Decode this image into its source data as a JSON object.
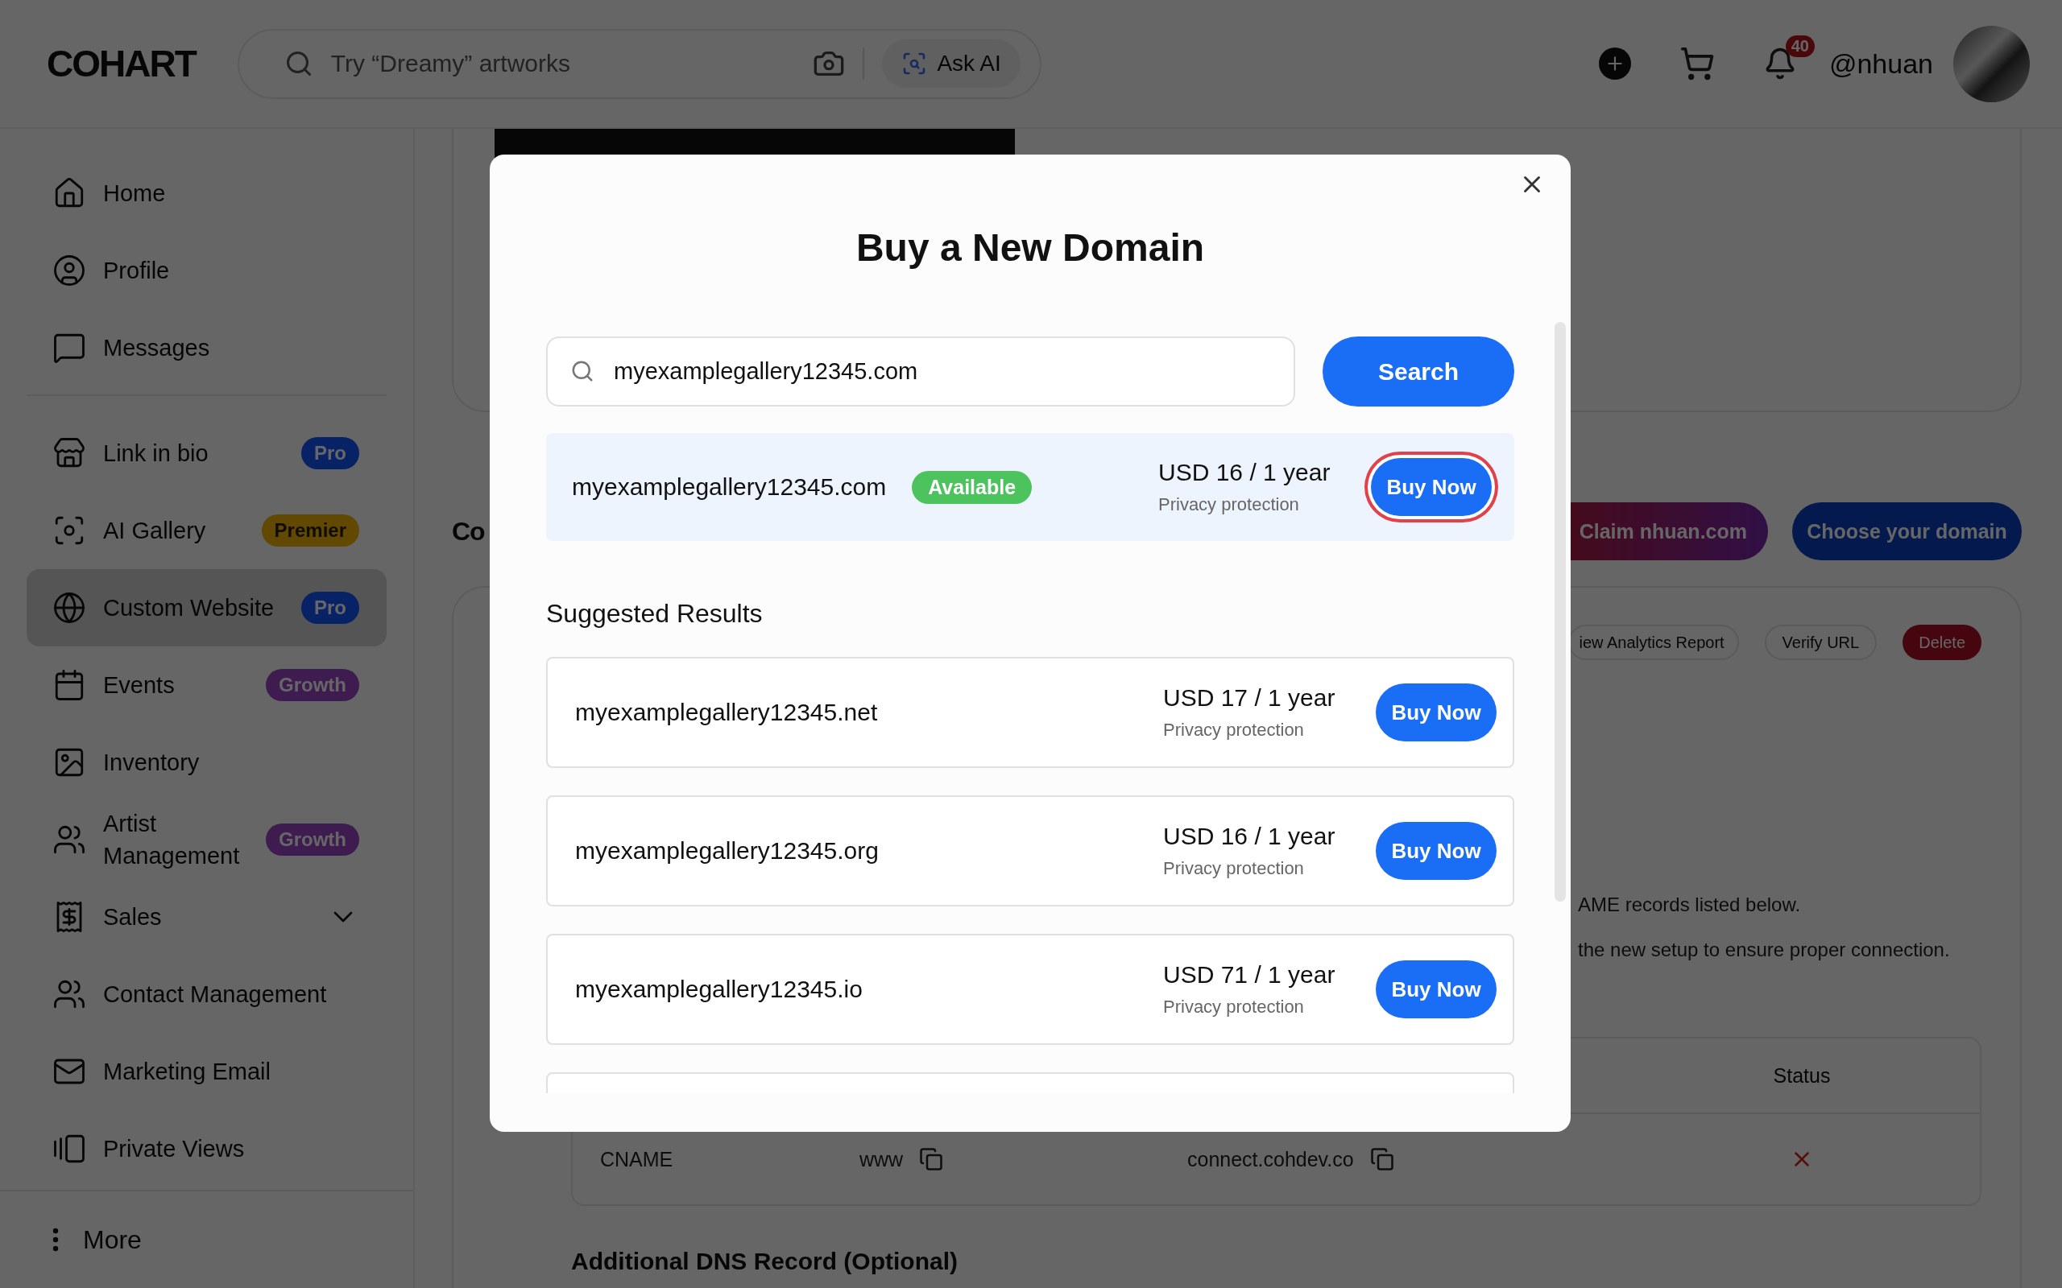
{
  "header": {
    "logo": "COHART",
    "search_placeholder": "Try “Dreamy” artworks",
    "ask_ai": "Ask AI",
    "notifications": "40",
    "username": "@nhuan"
  },
  "sidebar": {
    "groups": [
      [
        {
          "label": "Home",
          "selected": false
        },
        {
          "label": "Profile",
          "selected": false
        },
        {
          "label": "Messages",
          "selected": false
        }
      ],
      [
        {
          "label": "Link in bio",
          "badge": "Pro",
          "color": "#082266",
          "selected": false
        },
        {
          "label": "AI Gallery",
          "badge": "Premier",
          "color": "#614902",
          "selected": false
        },
        {
          "label": "Custom Website",
          "badge": "Pro",
          "color": "#082266",
          "selected": true
        },
        {
          "label": "Events",
          "badge": "Growth",
          "color": "#3e1c50",
          "selected": false
        },
        {
          "label": "Inventory",
          "selected": false
        },
        {
          "label": "Artist Management",
          "badge": "Growth",
          "color": "#3e1c50",
          "selected": false
        },
        {
          "label": "Sales",
          "expanded": false,
          "selected": false
        },
        {
          "label": "Contact Management",
          "selected": false
        },
        {
          "label": "Marketing Email",
          "selected": false
        },
        {
          "label": "Private Views",
          "selected": false
        }
      ]
    ],
    "more": "More"
  },
  "page": {
    "heading": "Co",
    "domain_buttons": [
      {
        "label": "Claim nhuan.com",
        "kind": "gradient"
      },
      {
        "label": "Choose your domain",
        "kind": "primary"
      }
    ],
    "card_actions": [
      {
        "label": "iew Analytics Report",
        "kind": "outline"
      },
      {
        "label": "Verify URL",
        "kind": "outline"
      },
      {
        "label": "Delete",
        "kind": "danger"
      }
    ],
    "notes": [
      "AME records listed below.",
      "the new setup to ensure proper connection."
    ],
    "dns_table": {
      "status_header": "Status",
      "rows": [
        {
          "type": "CNAME",
          "host": "www",
          "value": "connect.cohdev.co",
          "verified": false
        }
      ]
    },
    "additional_heading": "Additional DNS Record (Optional)"
  },
  "modal": {
    "title": "Buy a New Domain",
    "search": {
      "value": "myexamplegallery12345.com"
    },
    "search_button": "Search",
    "result": {
      "domain": "myexamplegallery12345.com",
      "status": "Available",
      "price": "USD 16 / 1 year",
      "note": "Privacy protection",
      "button": "Buy Now",
      "focused": true
    },
    "suggested_title": "Suggested Results",
    "suggestions": [
      {
        "domain": "myexamplegallery12345.net",
        "price": "USD 17 / 1 year",
        "note": "Privacy protection",
        "button": "Buy Now"
      },
      {
        "domain": "myexamplegallery12345.org",
        "price": "USD 16 / 1 year",
        "note": "Privacy protection",
        "button": "Buy Now"
      },
      {
        "domain": "myexamplegallery12345.io",
        "price": "USD 71 / 1 year",
        "note": "Privacy protection",
        "button": "Buy Now"
      }
    ]
  }
}
